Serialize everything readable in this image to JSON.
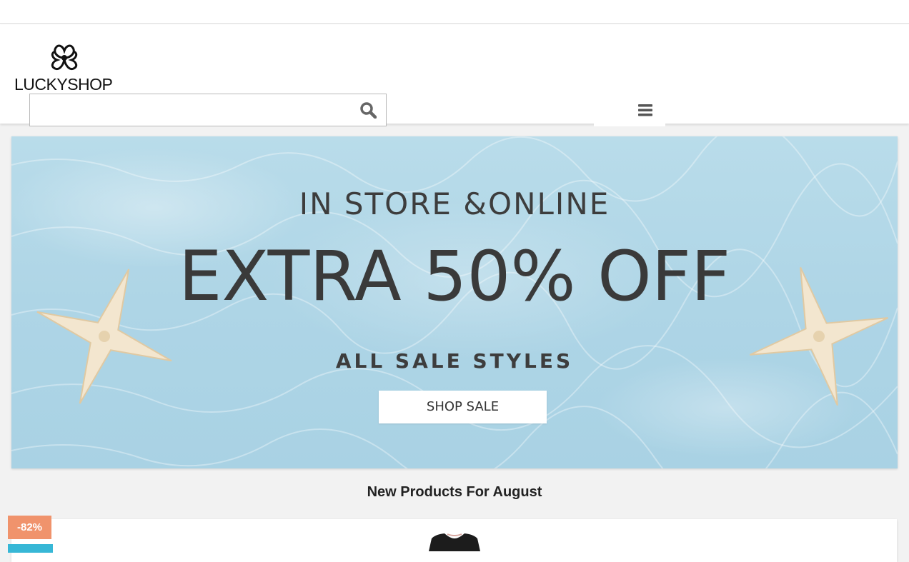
{
  "header": {
    "logo_text": "LUCKYSHOP",
    "search": {
      "placeholder": "",
      "value": ""
    }
  },
  "icons": {
    "logo": "clover-flower-icon",
    "search": "search-icon",
    "menu": "hamburger-menu-icon"
  },
  "banner": {
    "line1": "IN STORE &ONLINE",
    "line2": "EXTRA 50% OFF",
    "line3": "ALL SALE STYLES",
    "cta_label": "SHOP SALE"
  },
  "section": {
    "title": "New Products For August"
  },
  "products": [
    {
      "discount": "-82%"
    }
  ],
  "colors": {
    "discount_badge": "#f0936c",
    "secondary_badge": "#37b7d6",
    "banner_water": "#aed5e6"
  }
}
